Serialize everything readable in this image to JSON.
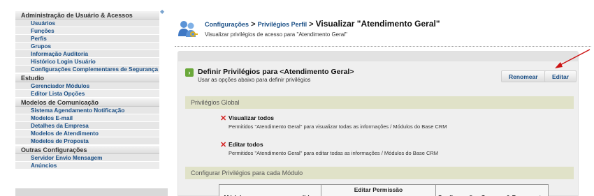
{
  "sidebar": {
    "sections": [
      {
        "title": "Administração de Usuário & Acessos",
        "items": [
          "Usuários",
          "Funções",
          "Perfis",
          "Grupos",
          "Informação Auditoria",
          "Histórico Login Usuário",
          "Configurações Complementares de Segurança"
        ]
      },
      {
        "title": "Estudio",
        "items": [
          "Gerenciador Módulos",
          "Editor Lista Opções"
        ]
      },
      {
        "title": "Modelos de Comunicação",
        "items": [
          "Sistema Agendamento Notificação",
          "Modelos E-mail",
          "Detalhes da Empresa",
          "Modelos de Atendimento",
          "Modelos de Proposta"
        ]
      },
      {
        "title": "Outras Configurações",
        "items": [
          "Servidor Envio Mensagem",
          "Anúncios"
        ]
      }
    ]
  },
  "header": {
    "breadcrumb": {
      "link1": "Configurações",
      "sep1": " > ",
      "link2": "Privilégios Perfil",
      "sep2": " > ",
      "current": "Visualizar \"Atendimento Geral\""
    },
    "subtitle": "Visualizar privilégios de acesso para \"Atendimento Geral\""
  },
  "main": {
    "section_title": "Definir Privilégios para <Atendimento Geral>",
    "section_subtitle": "Usar as opções abaixo para definir privilégios",
    "buttons": {
      "rename": "Renomear",
      "edit": "Editar"
    },
    "global_band": "Privilégios Global",
    "permissions": [
      {
        "mark": "✕",
        "title": "Visualizar todos",
        "desc": "Permitidos \"Atendimento Geral\" para visualizar todas as informações / Módulos do Base CRM"
      },
      {
        "mark": "✕",
        "title": "Editar todos",
        "desc": "Permitidos \"Atendimento Geral\" para editar todas as informações / Módulos do Base CRM"
      }
    ],
    "module_band": "Configurar Privilégios para cada Módulo",
    "table_headers": [
      "Módulos para serem concedidos",
      "Editar Permissão",
      "Configurações Campos & Ferramentas"
    ]
  },
  "colors": {
    "link": "#1a4f86",
    "band": "#e0e2c8",
    "deny": "#d42020",
    "annotation": "#cc1111"
  }
}
